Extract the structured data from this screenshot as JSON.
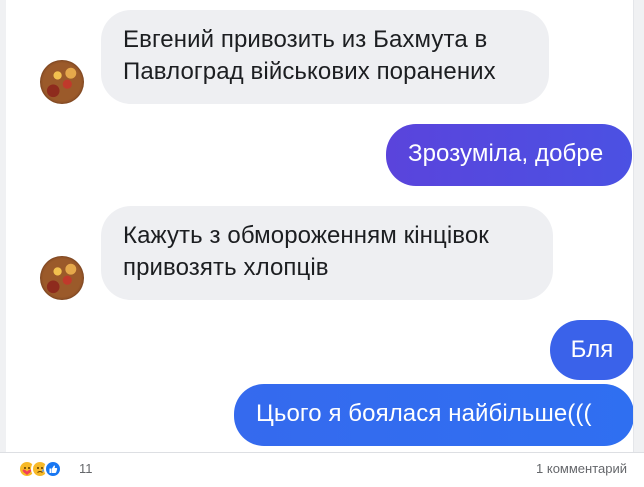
{
  "colors": {
    "incoming_bubble": "#eeeff2",
    "outgoing_bubble_gradient": [
      "#6b3fd4",
      "#4a56e2",
      "#2d6cf0"
    ],
    "meta_text": "#65676b"
  },
  "messages": [
    {
      "side": "incoming",
      "text": "Евгений привозить из Бахмута в Павлоград військових поранених",
      "avatar": "avatar-photo"
    },
    {
      "side": "outgoing",
      "text": "Зрозуміла, добре"
    },
    {
      "side": "incoming",
      "text": "Кажуть з обмороженням кінцівок привозять хлопців",
      "avatar": "avatar-photo"
    },
    {
      "side": "outgoing",
      "text": "Бля"
    },
    {
      "side": "outgoing",
      "text": "Цього я боялася найбільше((("
    }
  ],
  "footer": {
    "reactions": [
      "care-icon",
      "sad-icon",
      "like-icon"
    ],
    "reaction_count": "11",
    "comments_label": "1 комментарий"
  }
}
